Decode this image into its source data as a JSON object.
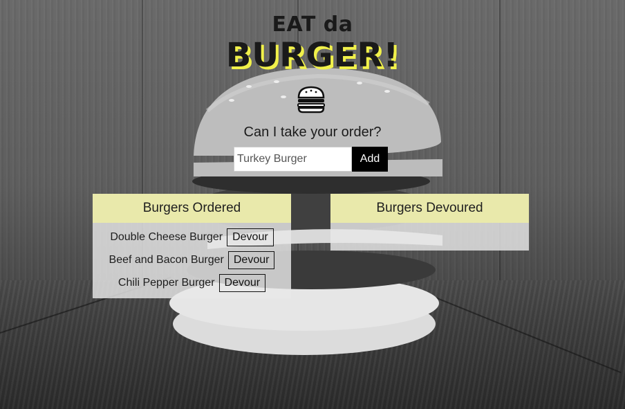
{
  "header": {
    "title_top": "EAT da",
    "title_main": "BURGER!",
    "logo_icon": "burger-icon",
    "accent_color": "#f1f14a"
  },
  "order": {
    "prompt": "Can I take your order?",
    "input_placeholder": "Turkey Burger",
    "input_value": "",
    "add_label": "Add"
  },
  "ordered": {
    "heading": "Burgers Ordered",
    "items": [
      {
        "name": "Double Cheese Burger",
        "action": "Devour"
      },
      {
        "name": "Beef and Bacon Burger",
        "action": "Devour"
      },
      {
        "name": "Chili Pepper Burger",
        "action": "Devour"
      }
    ]
  },
  "devoured": {
    "heading": "Burgers Devoured",
    "items": []
  }
}
